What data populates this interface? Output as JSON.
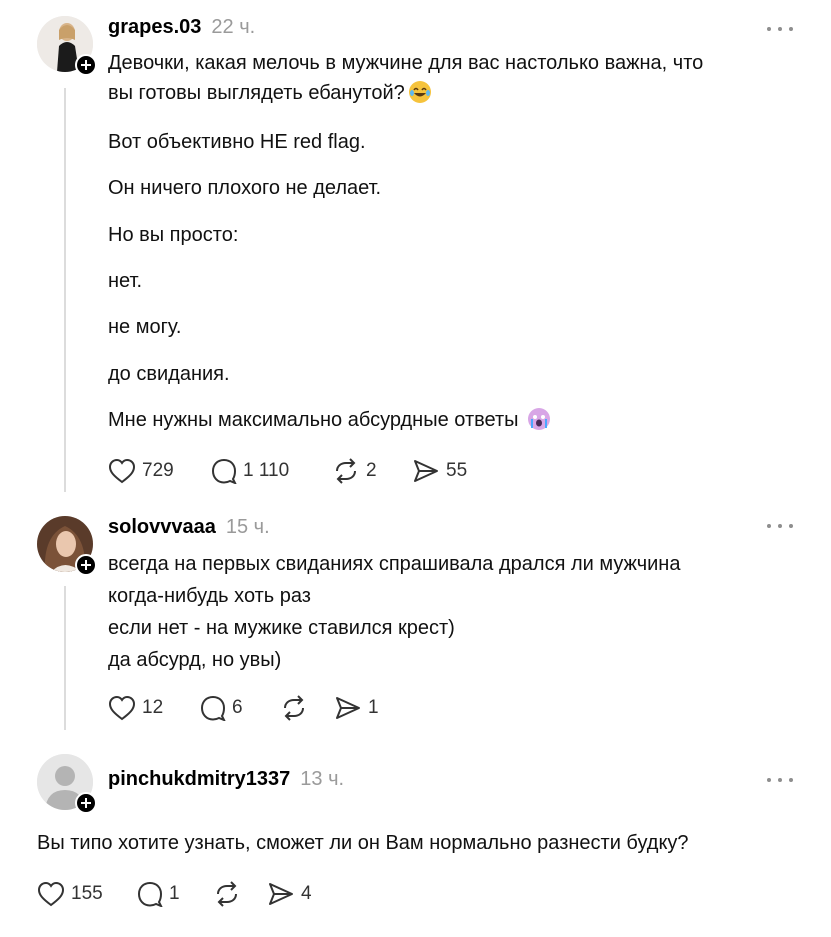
{
  "posts": [
    {
      "username": "grapes.03",
      "time": "22 ч.",
      "lines": [
        "Девочки, какая мелочь в мужчине для вас настолько важна, что",
        "вы готовы выглядеть ебанутой?",
        "Вот объективно НЕ red flag.",
        "Он ничего плохого не делает.",
        "Но вы просто:",
        "нет.",
        "не могу.",
        "до свидания.",
        "Мне нужны максимально абсурдные ответы"
      ],
      "emoji_1": "face-with-tears-of-joy-emoji",
      "emoji_2": "crying-face-emoji",
      "likes": "729",
      "comments": "1 110",
      "reposts": "2",
      "shares": "55"
    },
    {
      "username": "solovvvaaa",
      "time": "15 ч.",
      "lines": [
        "всегда на первых свиданиях спрашивала дрался ли мужчина",
        "когда-нибудь хоть раз",
        "если нет - на мужике ставился крест)",
        "да абсурд, но увы)"
      ],
      "likes": "12",
      "comments": "6",
      "reposts": "",
      "shares": "1"
    },
    {
      "username": "pinchukdmitry1337",
      "time": "13 ч.",
      "lines": [
        "Вы типо хотите узнать, сможет ли он Вам нормально разнести будку?"
      ],
      "likes": "155",
      "comments": "1",
      "reposts": "",
      "shares": "4"
    }
  ]
}
